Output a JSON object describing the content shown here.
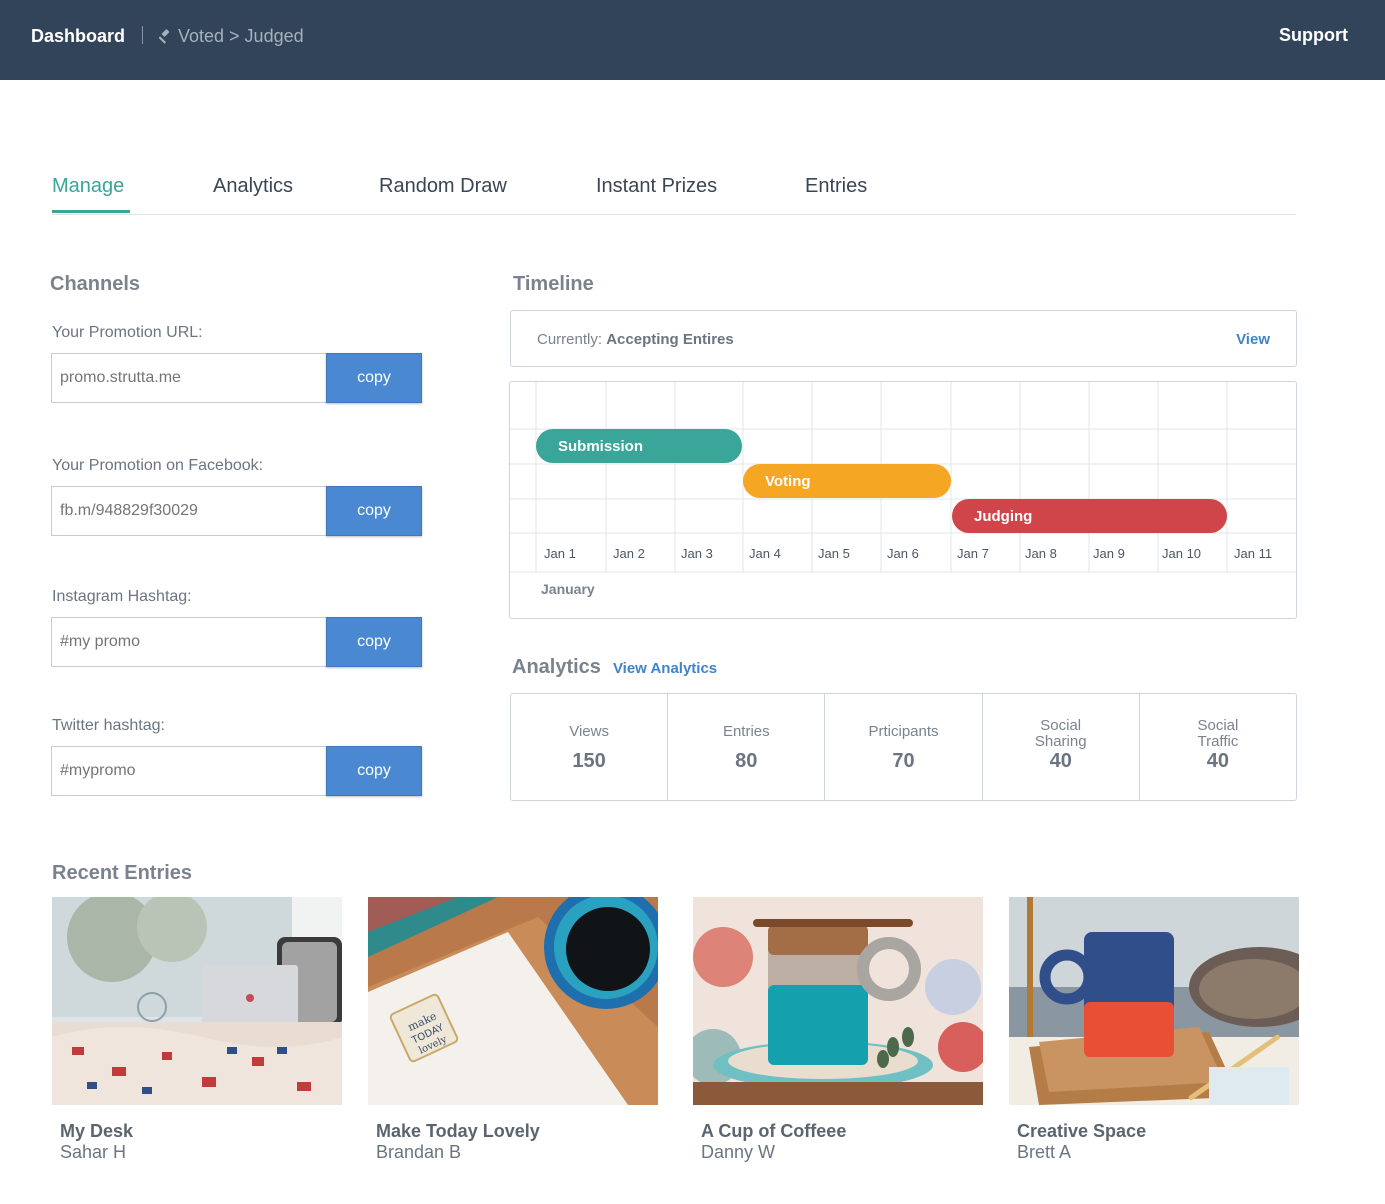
{
  "topbar": {
    "dashboard": "Dashboard",
    "breadcrumb": "Voted > Judged",
    "support": "Support"
  },
  "tabs": [
    {
      "label": "Manage"
    },
    {
      "label": "Analytics"
    },
    {
      "label": "Random Draw"
    },
    {
      "label": "Instant Prizes"
    },
    {
      "label": "Entries"
    }
  ],
  "channels": {
    "title": "Channels",
    "fields": [
      {
        "label": "Your Promotion URL:",
        "placeholder": "promo.strutta.me",
        "button": "copy"
      },
      {
        "label": "Your Promotion on Facebook:",
        "placeholder": "fb.m/948829f30029",
        "button": "copy"
      },
      {
        "label": "Instagram Hashtag:",
        "placeholder": "#my promo",
        "button": "copy"
      },
      {
        "label": "Twitter hashtag:",
        "placeholder": "#mypromo",
        "button": "copy"
      }
    ]
  },
  "timeline": {
    "title": "Timeline",
    "status_prefix": "Currently:",
    "status_value": "Accepting Entires",
    "view": "View",
    "days": [
      "Jan 1",
      "Jan 2",
      "Jan 3",
      "Jan 4",
      "Jan 5",
      "Jan 6",
      "Jan 7",
      "Jan 8",
      "Jan 9",
      "Jan 10",
      "Jan 11"
    ],
    "month": "January",
    "phases": [
      {
        "name": "Submission",
        "color": "#3aa599"
      },
      {
        "name": "Voting",
        "color": "#f5a623"
      },
      {
        "name": "Judging",
        "color": "#d0454a"
      }
    ]
  },
  "analytics": {
    "title": "Analytics",
    "link": "View Analytics",
    "stats": [
      {
        "label1": "Views",
        "label2": "",
        "value": "150"
      },
      {
        "label1": "Entries",
        "label2": "",
        "value": "80"
      },
      {
        "label1": "Prticipants",
        "label2": "",
        "value": "70"
      },
      {
        "label1": "Social",
        "label2": "Sharing",
        "value": "40"
      },
      {
        "label1": "Social",
        "label2": "Traffic",
        "value": "40"
      }
    ]
  },
  "recent": {
    "title": "Recent Entries",
    "entries": [
      {
        "title": "My Desk",
        "author": "Sahar H"
      },
      {
        "title": "Make Today Lovely",
        "author": "Brandan B"
      },
      {
        "title": "A Cup of Coffeee",
        "author": "Danny W"
      },
      {
        "title": "Creative Space",
        "author": "Brett A"
      }
    ]
  },
  "colors": {
    "topbar": "#324459",
    "accent": "#3aa599",
    "button": "#4a89d1",
    "link": "#3f84c9"
  }
}
